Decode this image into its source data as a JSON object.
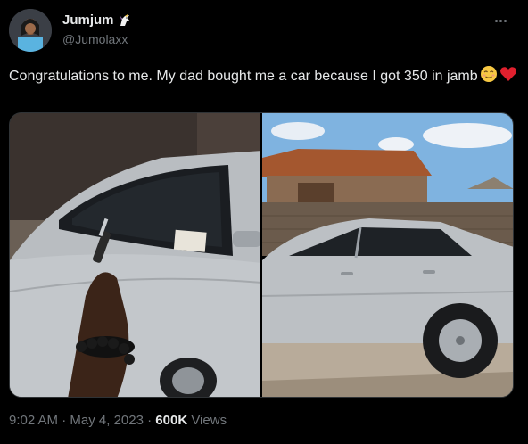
{
  "user": {
    "display_name": "Jumjum",
    "handle": "@Jumolaxx"
  },
  "tweet": {
    "text": "Congratulations to me. My dad bought  me a car because I got 350 in jamb"
  },
  "meta": {
    "time": "9:02 AM",
    "sep1": " · ",
    "date": "May 4, 2023",
    "sep2": " · ",
    "views_count": "600K",
    "views_label": " Views"
  },
  "icons": {
    "unicorn": "unicorn-emoji",
    "relieved_face": "relieved-face-emoji",
    "red_heart": "red-heart-emoji",
    "more": "more-options-icon"
  }
}
